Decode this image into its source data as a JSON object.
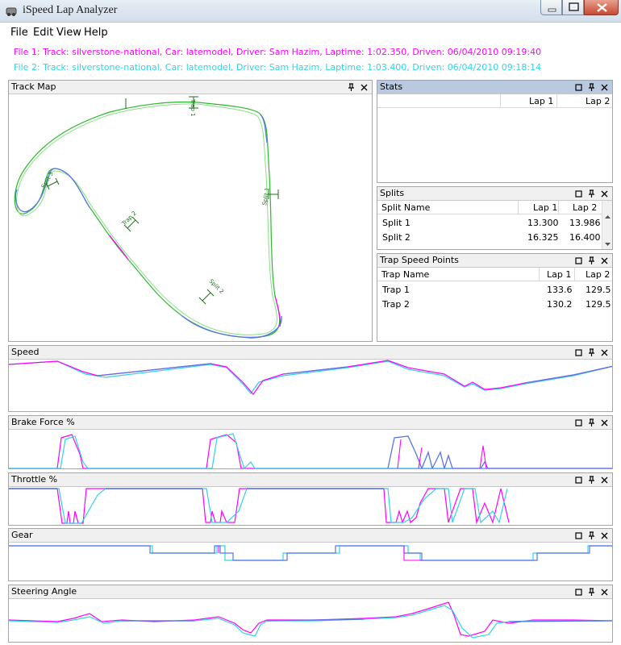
{
  "window": {
    "title": "iSpeed Lap Analyzer"
  },
  "menu": [
    "File",
    "Edit",
    "View",
    "Help"
  ],
  "files": {
    "file1": "File 1: Track: silverstone-national, Car: latemodel, Driver: Sam Hazim, Laptime: 1:02.350, Driven: 06/04/2010 09:19:40",
    "file2": "File 2: Track: silverstone-national, Car: latemodel, Driver: Sam Hazim, Laptime: 1:03.400, Driven: 06/04/2010 09:18:14"
  },
  "colors": {
    "lap1": "#ff00ff",
    "lap2": "#32d4e6",
    "overlap": "#5b74e6",
    "track": "#2db82d",
    "marker": "#1f6e1f"
  },
  "track_map": {
    "title": "Track Map",
    "markers": [
      "Trap 1",
      "Split 1",
      "Split 2",
      "Trap 2",
      "Split 3"
    ]
  },
  "stats": {
    "title": "Stats",
    "col_lap1": "Lap 1",
    "col_lap2": "Lap 2"
  },
  "splits": {
    "title": "Splits",
    "col_name": "Split Name",
    "col_lap1": "Lap 1",
    "col_lap2": "Lap 2",
    "rows": [
      {
        "name": "Split 1",
        "lap1": "13.300",
        "lap2": "13.986"
      },
      {
        "name": "Split 2",
        "lap1": "16.325",
        "lap2": "16.400"
      }
    ]
  },
  "traps": {
    "title": "Trap Speed Points",
    "col_name": "Trap Name",
    "col_lap1": "Lap 1",
    "col_lap2": "Lap 2",
    "rows": [
      {
        "name": "Trap 1",
        "lap1": "133.6",
        "lap2": "129.5"
      },
      {
        "name": "Trap 2",
        "lap1": "130.2",
        "lap2": "129.5"
      }
    ]
  },
  "graphs": {
    "speed": "Speed",
    "brake": "Brake Force %",
    "throttle": "Throttle %",
    "gear": "Gear",
    "steering": "Steering Angle"
  }
}
